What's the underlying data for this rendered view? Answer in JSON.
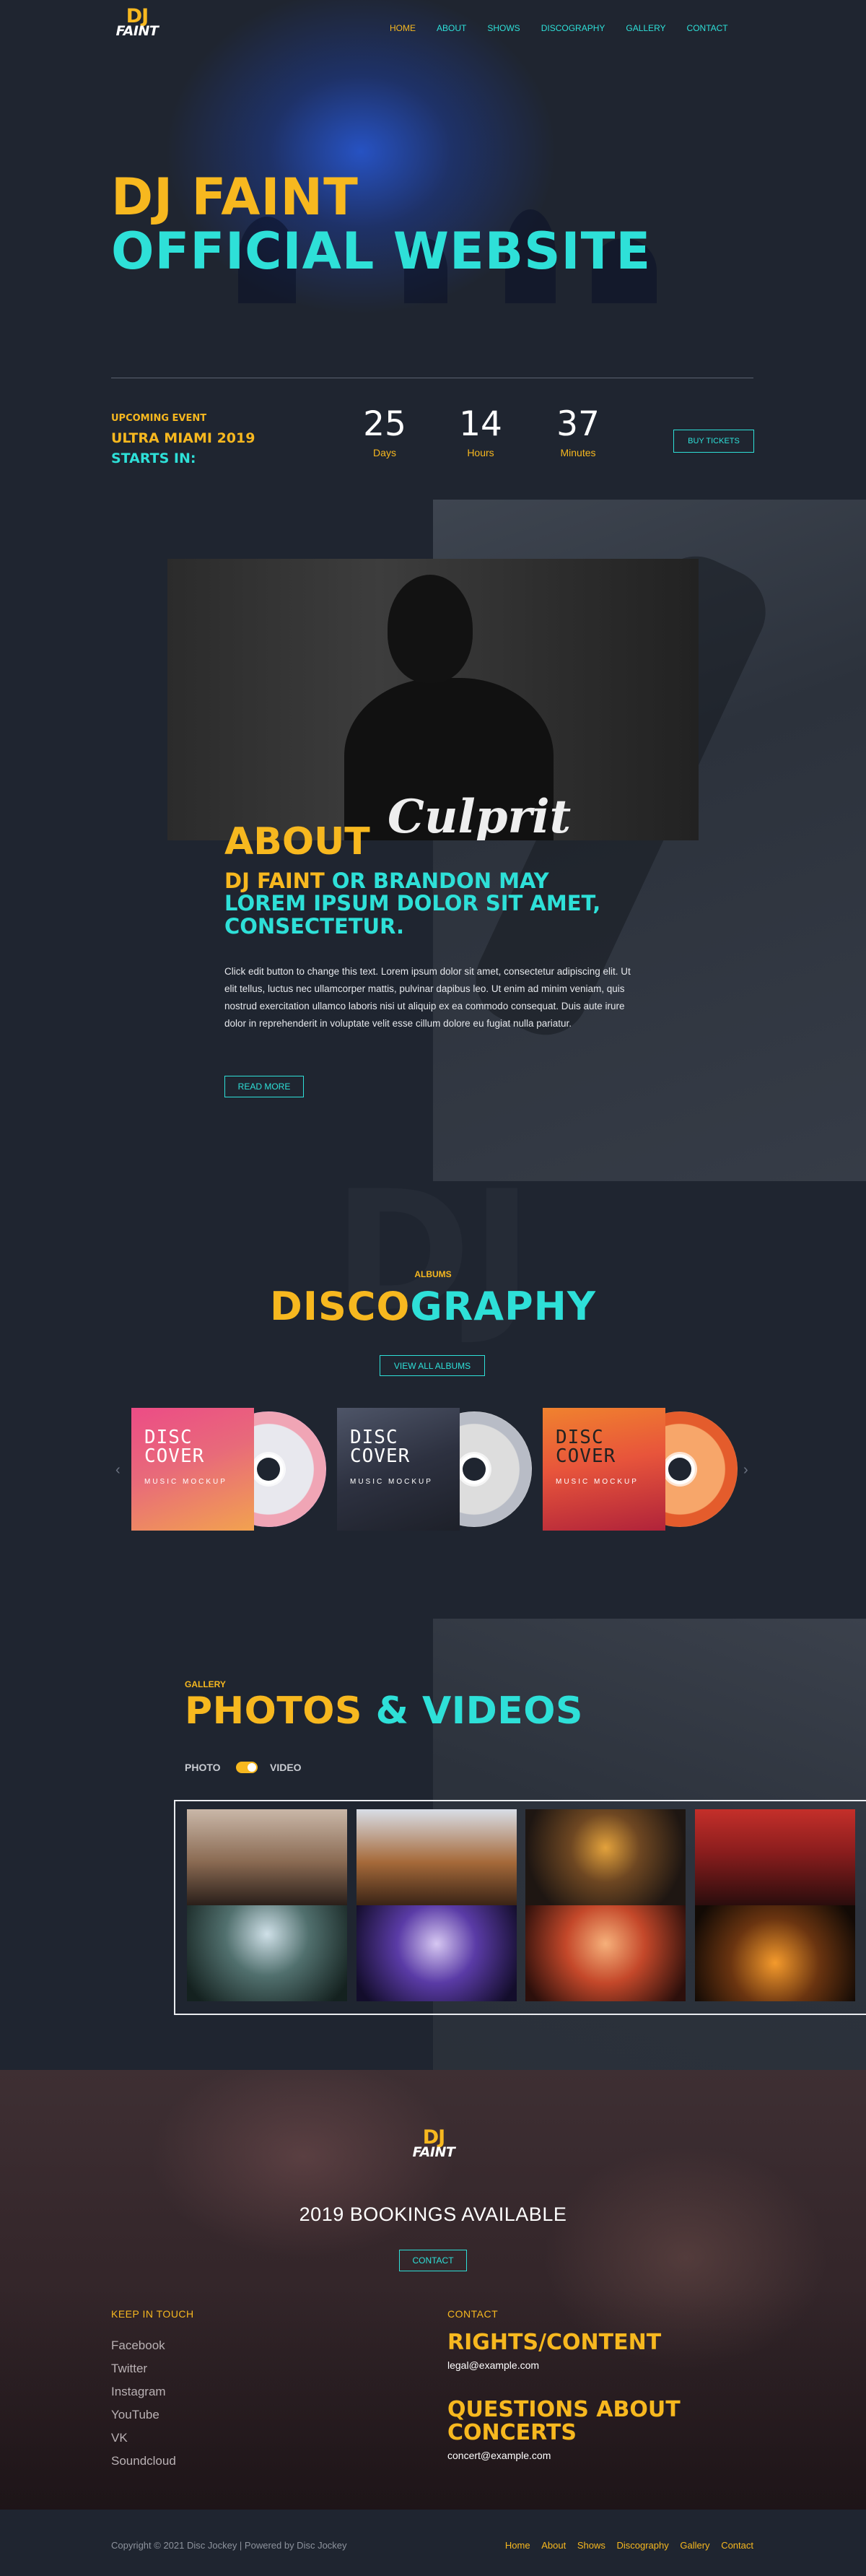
{
  "brand": {
    "logo_line1": "DJ",
    "logo_line2": "FAINT"
  },
  "nav": [
    {
      "label": "HOME",
      "active": true
    },
    {
      "label": "ABOUT"
    },
    {
      "label": "SHOWS"
    },
    {
      "label": "DISCOGRAPHY"
    },
    {
      "label": "GALLERY"
    },
    {
      "label": "CONTACT"
    }
  ],
  "hero": {
    "title_line1": "DJ FAINT",
    "title_line2": "OFFICIAL WEBSITE"
  },
  "event": {
    "kicker": "UPCOMING EVENT",
    "name": "ULTRA MIAMI 2019",
    "starts": "STARTS IN:",
    "countdown": [
      {
        "value": "25",
        "unit": "Days"
      },
      {
        "value": "14",
        "unit": "Hours"
      },
      {
        "value": "37",
        "unit": "Minutes"
      }
    ],
    "button": "BUY TICKETS"
  },
  "about": {
    "title": "ABOUT",
    "sub_yellow": "DJ FAINT",
    "sub_cyan_1": " OR BRANDON MAY",
    "sub_cyan_2": "LOREM IPSUM DOLOR SIT AMET,",
    "sub_cyan_3": "CONSECTETUR.",
    "shirt_text": "Culprit",
    "body": "Click edit button to change this text. Lorem ipsum dolor sit amet, consectetur adipiscing elit. Ut elit tellus, luctus nec ullamcorper mattis, pulvinar dapibus leo. Ut enim ad minim veniam, quis nostrud exercitation ullamco laboris nisi ut aliquip ex ea commodo consequat. Duis aute irure dolor in reprehenderit in voluptate velit esse cillum dolore eu fugiat nulla pariatur.",
    "button": "READ MORE"
  },
  "discography": {
    "kicker": "ALBUMS",
    "title_yellow": "DISCO",
    "title_cyan": "GRAPHY",
    "button": "VIEW ALL ALBUMS",
    "albums": [
      {
        "cover_line1": "DISC",
        "cover_line2": "COVER",
        "mockup": "MUSIC MOCKUP",
        "palette": "pink"
      },
      {
        "cover_line1": "DISC",
        "cover_line2": "COVER",
        "mockup": "MUSIC MOCKUP",
        "palette": "gray"
      },
      {
        "cover_line1": "DISC",
        "cover_line2": "COVER",
        "mockup": "MUSIC MOCKUP",
        "palette": "orange"
      }
    ],
    "prev_icon": "chevron-left-icon",
    "next_icon": "chevron-right-icon"
  },
  "gallery": {
    "kicker": "GALLERY",
    "title_yellow": "PHOTOS",
    "title_amp": " & ",
    "title_cyan": "VIDEOS",
    "toggle_left": "PHOTO",
    "toggle_right": "VIDEO"
  },
  "footer": {
    "booking": "2019 BOOKINGS AVAILABLE",
    "button": "CONTACT",
    "social_heading": "KEEP IN TOUCH",
    "social": [
      "Facebook",
      "Twitter",
      "Instagram",
      "YouTube",
      "VK",
      "Soundcloud"
    ],
    "contact_heading": "CONTACT",
    "rights_title": "RIGHTS/CONTENT",
    "rights_email": "legal@example.com",
    "concerts_title_1": "QUESTIONS ABOUT",
    "concerts_title_2": "CONCERTS",
    "concerts_email": "concert@example.com",
    "copyright": "Copyright © 2021 Disc Jockey | Powered by Disc Jockey",
    "bottom_nav": [
      "Home",
      "About",
      "Shows",
      "Discography",
      "Gallery",
      "Contact"
    ]
  },
  "colors": {
    "accent_yellow": "#f7b81f",
    "accent_cyan": "#2ee0d8",
    "background": "#1f2530"
  }
}
